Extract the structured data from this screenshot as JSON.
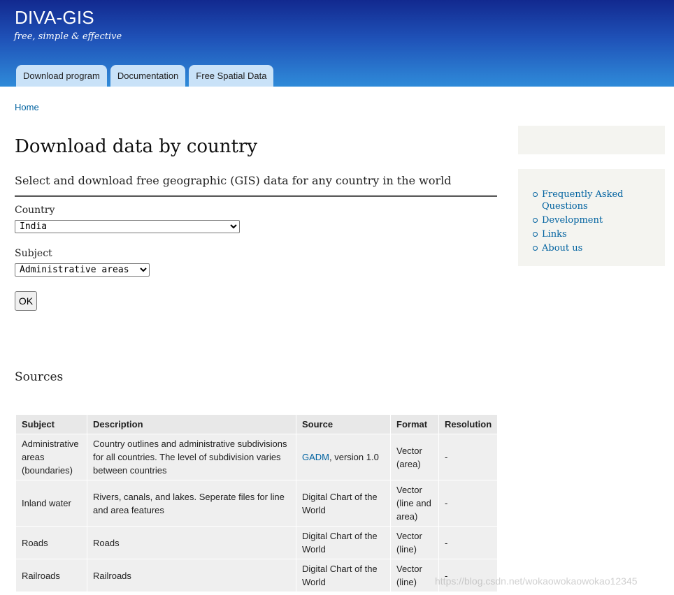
{
  "header": {
    "site_name": "DIVA-GIS",
    "slogan": "free, simple & effective",
    "tabs": [
      {
        "label": "Download program"
      },
      {
        "label": "Documentation"
      },
      {
        "label": "Free Spatial Data"
      }
    ]
  },
  "breadcrumb": {
    "home": "Home"
  },
  "main": {
    "title": "Download data by country",
    "subtitle": "Select and download free geographic (GIS) data for any country in the world",
    "country": {
      "label": "Country",
      "selected": "India"
    },
    "subject": {
      "label": "Subject",
      "selected": "Administrative areas"
    },
    "ok_label": "OK",
    "sources_title": "Sources",
    "table": {
      "headers": [
        "Subject",
        "Description",
        "Source",
        "Format",
        "Resolution"
      ],
      "rows": [
        {
          "subject": "Administrative areas (boundaries)",
          "description": "Country outlines and administrative subdivisions for all countries. The level of subdivision varies between countries",
          "source_link": "GADM",
          "source_rest": ", version 1.0",
          "format": "Vector (area)",
          "resolution": "-"
        },
        {
          "subject": "Inland water",
          "description": "Rivers, canals, and lakes. Seperate files for line and area features",
          "source_link": "",
          "source_rest": "Digital Chart of the World",
          "format": "Vector (line and area)",
          "resolution": "-"
        },
        {
          "subject": "Roads",
          "description": "Roads",
          "source_link": "",
          "source_rest": "Digital Chart of the World",
          "format": "Vector (line)",
          "resolution": "-"
        },
        {
          "subject": "Railroads",
          "description": "Railroads",
          "source_link": "",
          "source_rest": "Digital Chart of the World",
          "format": "Vector (line)",
          "resolution": "-"
        }
      ]
    }
  },
  "sidebar": {
    "links": [
      {
        "label": "Frequently Asked Questions"
      },
      {
        "label": "Development"
      },
      {
        "label": "Links"
      },
      {
        "label": "About us"
      }
    ]
  },
  "watermark": "https://blog.csdn.net/wokaowokaowokao12345"
}
